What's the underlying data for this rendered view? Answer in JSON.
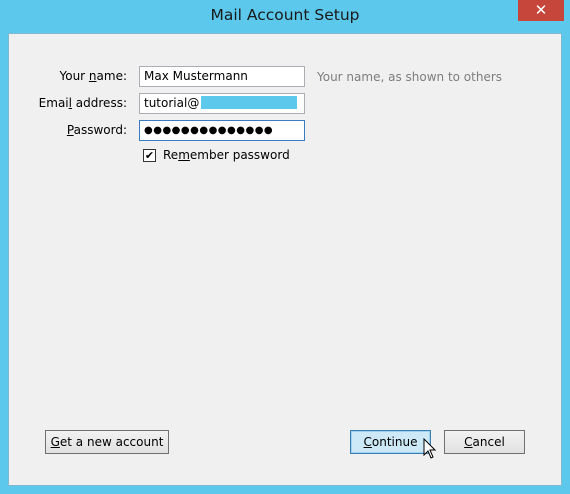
{
  "window": {
    "title": "Mail Account Setup",
    "close_glyph": "✕"
  },
  "form": {
    "name_label_pre": "Your ",
    "name_label_ul": "n",
    "name_label_post": "ame:",
    "name_value": "Max Mustermann",
    "name_hint": "Your name, as shown to others",
    "email_label_pre": "Emai",
    "email_label_ul": "l",
    "email_label_post": " address:",
    "email_value": "tutorial@",
    "password_label_pre": "",
    "password_label_ul": "P",
    "password_label_post": "assword:",
    "password_value": "●●●●●●●●●●●●●●",
    "remember_checked_glyph": "✔",
    "remember_label_pre": "Re",
    "remember_label_ul": "m",
    "remember_label_post": "ember password"
  },
  "buttons": {
    "get_account_ul": "G",
    "get_account_post": "et a new account",
    "continue_ul": "C",
    "continue_post": "ontinue",
    "cancel_pre": "",
    "cancel_ul": "C",
    "cancel_post": "ancel"
  },
  "colors": {
    "frame": "#5cc8ec",
    "close_button": "#c7463b",
    "primary_button": "#cde8f7"
  }
}
